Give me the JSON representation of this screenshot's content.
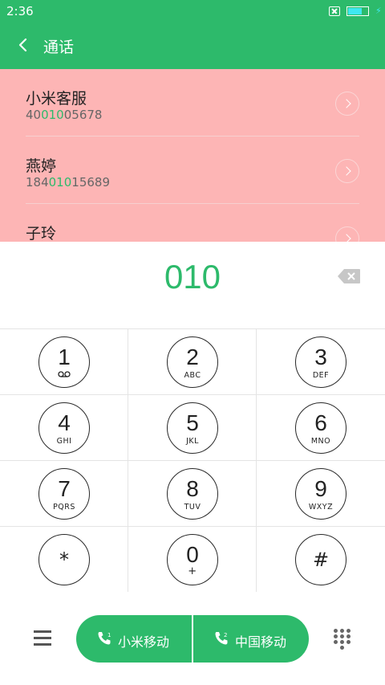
{
  "status": {
    "time": "2:36",
    "battery_level": 0.75
  },
  "header": {
    "title": "通话"
  },
  "results": [
    {
      "name": "小米客服",
      "number_prefix": "40",
      "number_match": "010",
      "number_suffix": "05678"
    },
    {
      "name": "燕婷",
      "number_prefix": "184",
      "number_match": "010",
      "number_suffix": "15689"
    },
    {
      "name": "子玲"
    }
  ],
  "dial": {
    "number": "010"
  },
  "keypad": {
    "keys": [
      {
        "digit": "1",
        "letters": ""
      },
      {
        "digit": "2",
        "letters": "ABC"
      },
      {
        "digit": "3",
        "letters": "DEF"
      },
      {
        "digit": "4",
        "letters": "GHI"
      },
      {
        "digit": "5",
        "letters": "JKL"
      },
      {
        "digit": "6",
        "letters": "MNO"
      },
      {
        "digit": "7",
        "letters": "PQRS"
      },
      {
        "digit": "8",
        "letters": "TUV"
      },
      {
        "digit": "9",
        "letters": "WXYZ"
      },
      {
        "digit": "*",
        "letters": ""
      },
      {
        "digit": "0",
        "letters": "+"
      },
      {
        "digit": "#",
        "letters": ""
      }
    ]
  },
  "call": {
    "sim1_label": "小米移动",
    "sim1_index": "1",
    "sim2_label": "中国移动",
    "sim2_index": "2"
  },
  "colors": {
    "accent": "#2dba6b",
    "highlight_bg": "#fdb5b5"
  }
}
